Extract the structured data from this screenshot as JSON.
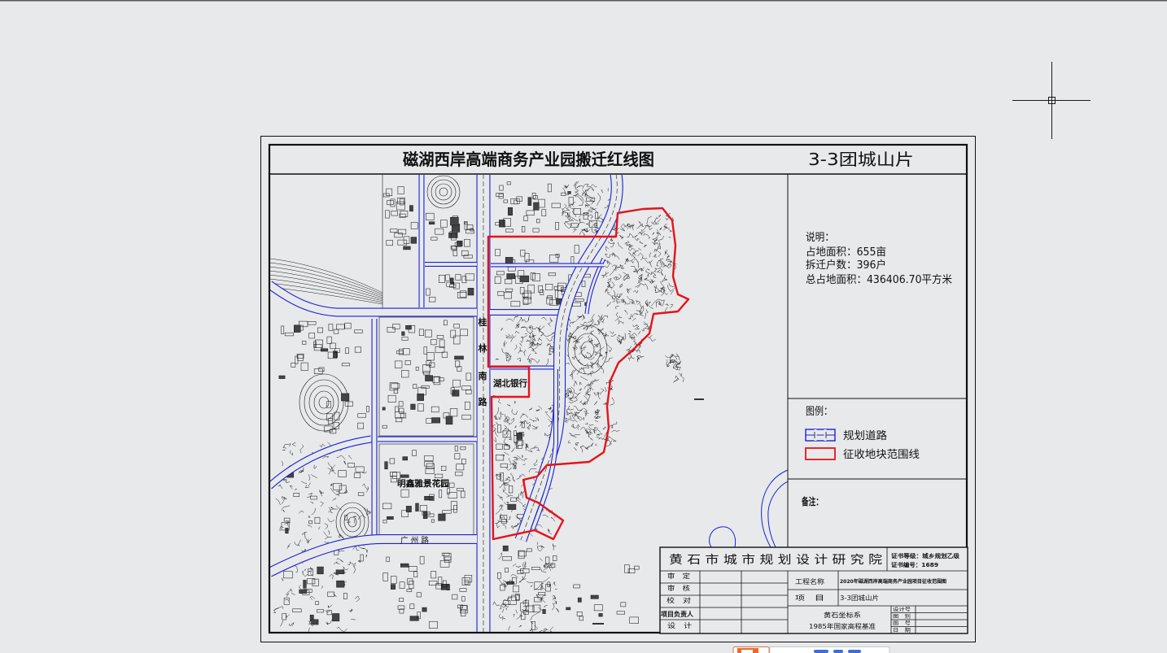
{
  "drawing": {
    "title": "磁湖西岸高端商务产业园搬迁红线图",
    "subtitle": "3-3团城山片"
  },
  "notes": {
    "heading": "说明：",
    "area": "占地面积：655亩",
    "households": "拆迁户数：396户",
    "total_area": "总占地面积：436406.70平方米"
  },
  "legend": {
    "heading": "图例：",
    "items": [
      {
        "label": "规划道路",
        "symbol": "planned-road-symbol",
        "color": "#1a22d0"
      },
      {
        "label": "征收地块范围线",
        "symbol": "acquisition-boundary-symbol",
        "color": "#e3141b"
      }
    ]
  },
  "remarks": {
    "heading": "备注："
  },
  "map_labels": {
    "guilin_road": [
      "桂",
      "林",
      "南",
      "路"
    ],
    "bank": "湖北银行",
    "garden": "明鑫雅景花园",
    "guangzhou_road": "广 州 路"
  },
  "title_block": {
    "institute": "黄 石 市 城 市 规 划 设 计 研 究 院",
    "cert_level": "证书等级：城乡规划乙级",
    "cert_number": "证书编号：1689",
    "roles": [
      "审　定",
      "审　核",
      "校　对",
      "项目负责人",
      "设　计"
    ],
    "project_label": "工程名称",
    "project_name": "2020年磁湖西岸高端商务产业园项目征收范围图",
    "item_label": "项　目",
    "item_value": "3-3团城山片",
    "coordinate_system": "黄石坐标系",
    "elevation_datum": "1985年国家高程基准",
    "sheet_fields": [
      "设计号",
      "图　别",
      "图　号",
      "日　期"
    ]
  },
  "cursor": {
    "icon": "crosshair-cursor-icon"
  },
  "taskbar": {
    "app_icon": "app-icon"
  },
  "colors": {
    "background": "#e8e9eb",
    "road": "#1a22d0",
    "boundary": "#e3141b",
    "linework": "#1c1c1c"
  }
}
